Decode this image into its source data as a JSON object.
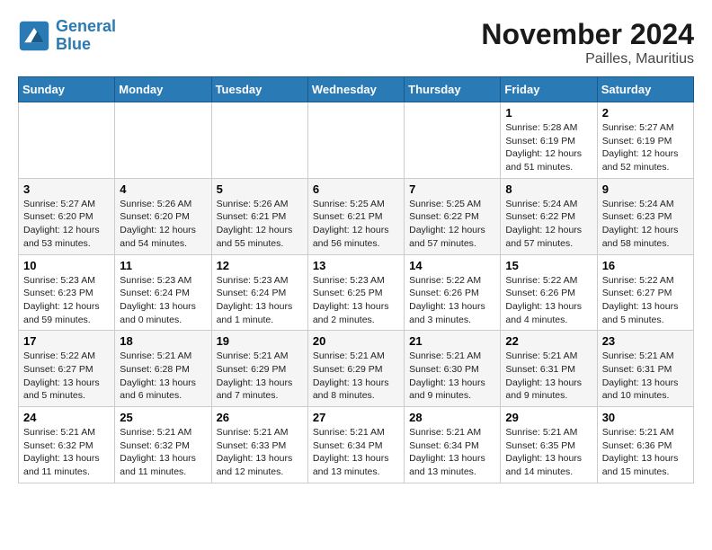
{
  "header": {
    "logo_line1": "General",
    "logo_line2": "Blue",
    "main_title": "November 2024",
    "subtitle": "Pailles, Mauritius"
  },
  "weekdays": [
    "Sunday",
    "Monday",
    "Tuesday",
    "Wednesday",
    "Thursday",
    "Friday",
    "Saturday"
  ],
  "weeks": [
    [
      {
        "day": "",
        "info": ""
      },
      {
        "day": "",
        "info": ""
      },
      {
        "day": "",
        "info": ""
      },
      {
        "day": "",
        "info": ""
      },
      {
        "day": "",
        "info": ""
      },
      {
        "day": "1",
        "info": "Sunrise: 5:28 AM\nSunset: 6:19 PM\nDaylight: 12 hours\nand 51 minutes."
      },
      {
        "day": "2",
        "info": "Sunrise: 5:27 AM\nSunset: 6:19 PM\nDaylight: 12 hours\nand 52 minutes."
      }
    ],
    [
      {
        "day": "3",
        "info": "Sunrise: 5:27 AM\nSunset: 6:20 PM\nDaylight: 12 hours\nand 53 minutes."
      },
      {
        "day": "4",
        "info": "Sunrise: 5:26 AM\nSunset: 6:20 PM\nDaylight: 12 hours\nand 54 minutes."
      },
      {
        "day": "5",
        "info": "Sunrise: 5:26 AM\nSunset: 6:21 PM\nDaylight: 12 hours\nand 55 minutes."
      },
      {
        "day": "6",
        "info": "Sunrise: 5:25 AM\nSunset: 6:21 PM\nDaylight: 12 hours\nand 56 minutes."
      },
      {
        "day": "7",
        "info": "Sunrise: 5:25 AM\nSunset: 6:22 PM\nDaylight: 12 hours\nand 57 minutes."
      },
      {
        "day": "8",
        "info": "Sunrise: 5:24 AM\nSunset: 6:22 PM\nDaylight: 12 hours\nand 57 minutes."
      },
      {
        "day": "9",
        "info": "Sunrise: 5:24 AM\nSunset: 6:23 PM\nDaylight: 12 hours\nand 58 minutes."
      }
    ],
    [
      {
        "day": "10",
        "info": "Sunrise: 5:23 AM\nSunset: 6:23 PM\nDaylight: 12 hours\nand 59 minutes."
      },
      {
        "day": "11",
        "info": "Sunrise: 5:23 AM\nSunset: 6:24 PM\nDaylight: 13 hours\nand 0 minutes."
      },
      {
        "day": "12",
        "info": "Sunrise: 5:23 AM\nSunset: 6:24 PM\nDaylight: 13 hours\nand 1 minute."
      },
      {
        "day": "13",
        "info": "Sunrise: 5:23 AM\nSunset: 6:25 PM\nDaylight: 13 hours\nand 2 minutes."
      },
      {
        "day": "14",
        "info": "Sunrise: 5:22 AM\nSunset: 6:26 PM\nDaylight: 13 hours\nand 3 minutes."
      },
      {
        "day": "15",
        "info": "Sunrise: 5:22 AM\nSunset: 6:26 PM\nDaylight: 13 hours\nand 4 minutes."
      },
      {
        "day": "16",
        "info": "Sunrise: 5:22 AM\nSunset: 6:27 PM\nDaylight: 13 hours\nand 5 minutes."
      }
    ],
    [
      {
        "day": "17",
        "info": "Sunrise: 5:22 AM\nSunset: 6:27 PM\nDaylight: 13 hours\nand 5 minutes."
      },
      {
        "day": "18",
        "info": "Sunrise: 5:21 AM\nSunset: 6:28 PM\nDaylight: 13 hours\nand 6 minutes."
      },
      {
        "day": "19",
        "info": "Sunrise: 5:21 AM\nSunset: 6:29 PM\nDaylight: 13 hours\nand 7 minutes."
      },
      {
        "day": "20",
        "info": "Sunrise: 5:21 AM\nSunset: 6:29 PM\nDaylight: 13 hours\nand 8 minutes."
      },
      {
        "day": "21",
        "info": "Sunrise: 5:21 AM\nSunset: 6:30 PM\nDaylight: 13 hours\nand 9 minutes."
      },
      {
        "day": "22",
        "info": "Sunrise: 5:21 AM\nSunset: 6:31 PM\nDaylight: 13 hours\nand 9 minutes."
      },
      {
        "day": "23",
        "info": "Sunrise: 5:21 AM\nSunset: 6:31 PM\nDaylight: 13 hours\nand 10 minutes."
      }
    ],
    [
      {
        "day": "24",
        "info": "Sunrise: 5:21 AM\nSunset: 6:32 PM\nDaylight: 13 hours\nand 11 minutes."
      },
      {
        "day": "25",
        "info": "Sunrise: 5:21 AM\nSunset: 6:32 PM\nDaylight: 13 hours\nand 11 minutes."
      },
      {
        "day": "26",
        "info": "Sunrise: 5:21 AM\nSunset: 6:33 PM\nDaylight: 13 hours\nand 12 minutes."
      },
      {
        "day": "27",
        "info": "Sunrise: 5:21 AM\nSunset: 6:34 PM\nDaylight: 13 hours\nand 13 minutes."
      },
      {
        "day": "28",
        "info": "Sunrise: 5:21 AM\nSunset: 6:34 PM\nDaylight: 13 hours\nand 13 minutes."
      },
      {
        "day": "29",
        "info": "Sunrise: 5:21 AM\nSunset: 6:35 PM\nDaylight: 13 hours\nand 14 minutes."
      },
      {
        "day": "30",
        "info": "Sunrise: 5:21 AM\nSunset: 6:36 PM\nDaylight: 13 hours\nand 15 minutes."
      }
    ]
  ]
}
